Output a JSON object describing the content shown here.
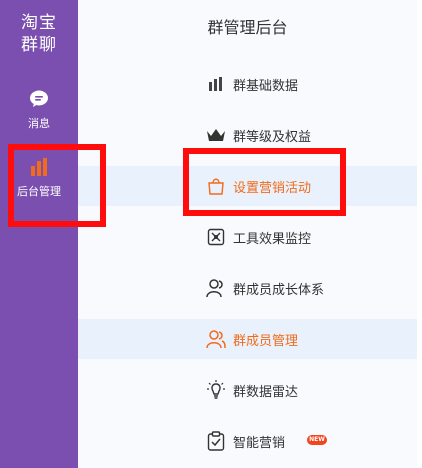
{
  "sidebar": {
    "brand_line1": "淘宝",
    "brand_line2": "群聊",
    "items": [
      {
        "label": "消息",
        "icon": "chat-bubble-icon"
      },
      {
        "label": "后台管理",
        "icon": "bar-chart-icon"
      }
    ],
    "background_color": "#7a4fb0"
  },
  "main": {
    "title": "群管理后台",
    "menu": [
      {
        "label": "群基础数据",
        "icon": "bar-chart-icon"
      },
      {
        "label": "群等级及权益",
        "icon": "crown-icon"
      },
      {
        "label": "设置营销活动",
        "icon": "shopping-bag-icon",
        "state": "highlighted"
      },
      {
        "label": "工具效果监控",
        "icon": "monitor-tool-icon"
      },
      {
        "label": "群成员成长体系",
        "icon": "user-icon"
      },
      {
        "label": "群成员管理",
        "icon": "users-icon",
        "state": "highlighted"
      },
      {
        "label": "群数据雷达",
        "icon": "lightbulb-icon"
      },
      {
        "label": "智能营销",
        "icon": "clipboard-check-icon",
        "badge": "NEW"
      }
    ]
  },
  "colors": {
    "accent_orange": "#f26a1b",
    "highlight_red": "#ff0d0d",
    "active_row_bg": "#e9f2fc"
  }
}
